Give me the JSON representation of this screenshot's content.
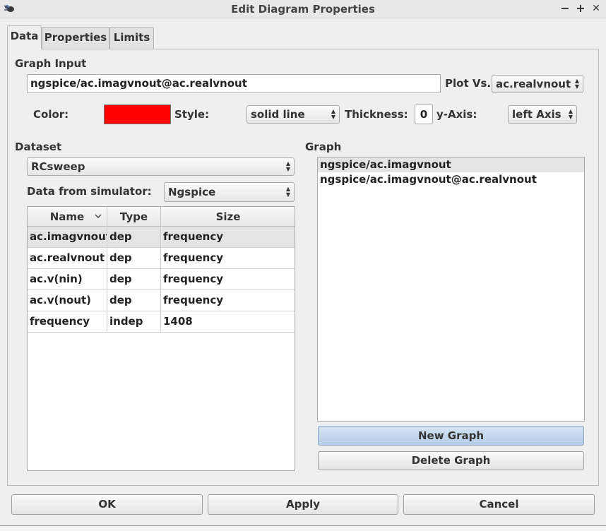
{
  "window": {
    "title": "Edit Diagram Properties",
    "buttons": {
      "minimize": "−",
      "maximize": "+",
      "close": "✕"
    }
  },
  "tabs": [
    {
      "label": "Data"
    },
    {
      "label": "Properties"
    },
    {
      "label": "Limits"
    }
  ],
  "graph_input": {
    "section_label": "Graph Input",
    "value": "ngspice/ac.imagvnout@ac.realvnout",
    "plot_vs_label": "Plot Vs.",
    "plot_vs_value": "ac.realvnout",
    "color_label": "Color:",
    "color_value": "#ff0000",
    "style_label": "Style:",
    "style_value": "solid line",
    "thickness_label": "Thickness:",
    "thickness_value": "0",
    "yaxis_label": "y-Axis:",
    "yaxis_value": "left Axis"
  },
  "dataset": {
    "section_label": "Dataset",
    "value": "RCsweep",
    "simulator_label": "Data from simulator:",
    "simulator_value": "Ngspice",
    "table": {
      "headers": [
        "Name",
        "Type",
        "Size"
      ],
      "rows": [
        [
          "ac.imagvnout",
          "dep",
          "frequency"
        ],
        [
          "ac.realvnout",
          "dep",
          "frequency"
        ],
        [
          "ac.v(nin)",
          "dep",
          "frequency"
        ],
        [
          "ac.v(nout)",
          "dep",
          "frequency"
        ],
        [
          "frequency",
          "indep",
          "1408"
        ]
      ]
    }
  },
  "graph": {
    "section_label": "Graph",
    "items": [
      "ngspice/ac.imagvnout",
      "ngspice/ac.imagvnout@ac.realvnout"
    ],
    "new_button": "New Graph",
    "delete_button": "Delete Graph"
  },
  "dialog_buttons": {
    "ok": "OK",
    "apply": "Apply",
    "cancel": "Cancel"
  }
}
